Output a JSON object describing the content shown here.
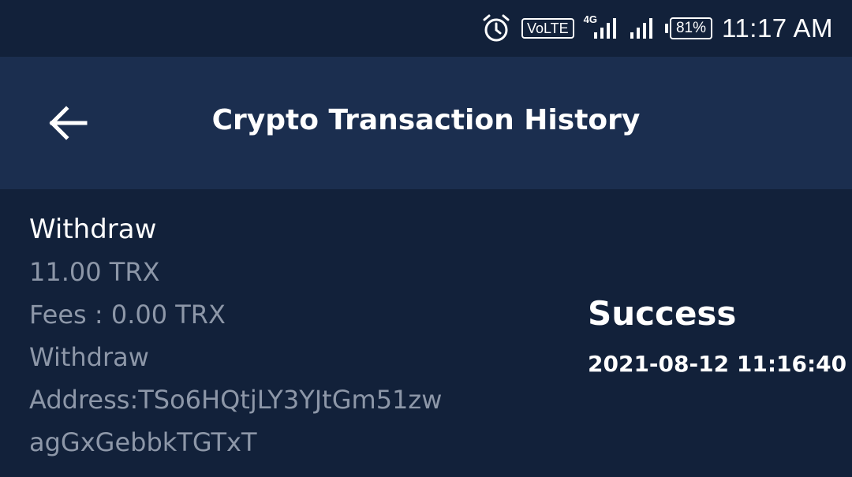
{
  "status_bar": {
    "alarm_icon": "alarm-clock-icon",
    "volte_label": "VoLTE",
    "network_label": "4G",
    "battery": "81%",
    "time": "11:17 AM"
  },
  "header": {
    "back_icon": "arrow-left-icon",
    "title": "Crypto Transaction History"
  },
  "transaction": {
    "type": "Withdraw",
    "amount": "11.00 TRX",
    "fees": "Fees : 0.00 TRX",
    "description": "Withdraw",
    "address_line1": "Address:TSo6HQtjLY3YJtGm51zw",
    "address_line2": "agGxGebbkTGTxT",
    "status": "Success",
    "datetime": "2021-08-12 11:16:40"
  },
  "colors": {
    "background": "#12213a",
    "app_bar": "#1b2e4f",
    "muted_text": "#8d97a8",
    "primary_text": "#ffffff"
  }
}
